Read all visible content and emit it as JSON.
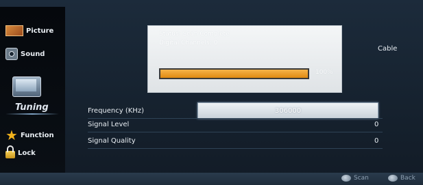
{
  "sidebar": {
    "items": [
      {
        "label": "Picture",
        "icon": "picture-icon"
      },
      {
        "label": "Sound",
        "icon": "speaker-icon"
      },
      {
        "label": "Tuning",
        "icon": "tv-icon",
        "selected": true
      },
      {
        "label": "Function",
        "icon": "star-icon"
      },
      {
        "label": "Lock",
        "icon": "lock-icon"
      }
    ]
  },
  "dialog": {
    "status": "Status: Scan Complete",
    "channels": "Digital Channels: 0",
    "progress_fraction": 1.0,
    "progress_text": "100%"
  },
  "source": "Cable",
  "rows": [
    {
      "label": "Frequency (KHz)",
      "value": "306000"
    },
    {
      "label": "Signal Level",
      "value": "0"
    },
    {
      "label": "Signal Quality",
      "value": "0"
    }
  ],
  "footer": {
    "scan": "Scan",
    "back": "Back"
  },
  "colors": {
    "progress": "#f0a030",
    "background": "#1a2837",
    "sidebar": "#080c11"
  }
}
